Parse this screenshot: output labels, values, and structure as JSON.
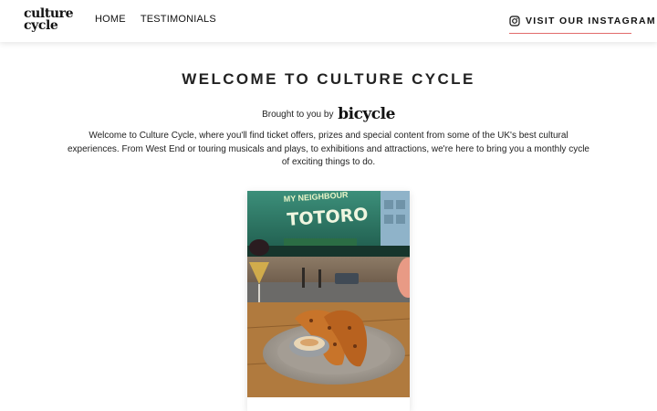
{
  "header": {
    "logo": {
      "line1": "culture",
      "line2": "cycle"
    },
    "nav": [
      {
        "label": "HOME"
      },
      {
        "label": "TESTIMONIALS"
      }
    ],
    "instagram": {
      "label": "VISIT OUR INSTAGRAM",
      "icon": "instagram-icon",
      "underline_color": "#e26b6b"
    }
  },
  "main": {
    "title": "WELCOME TO CULTURE CYCLE",
    "brought_by": {
      "prefix": "Brought to you by",
      "brand": "bicycle"
    },
    "intro_line1": "Welcome to Culture Cycle, where you'll find ticket offers, prizes and special content from some of the UK's best cultural",
    "intro_line2": "experiences.  From West End or touring musicals and plays, to exhibitions and attractions, we're here to bring you a monthly cycle",
    "intro_line3": "of exciting things to do.",
    "card": {
      "image": "photo-theatre-street-food",
      "sign_line1": "MY NEIGHBOUR",
      "sign_line2": "TOTORO"
    }
  }
}
